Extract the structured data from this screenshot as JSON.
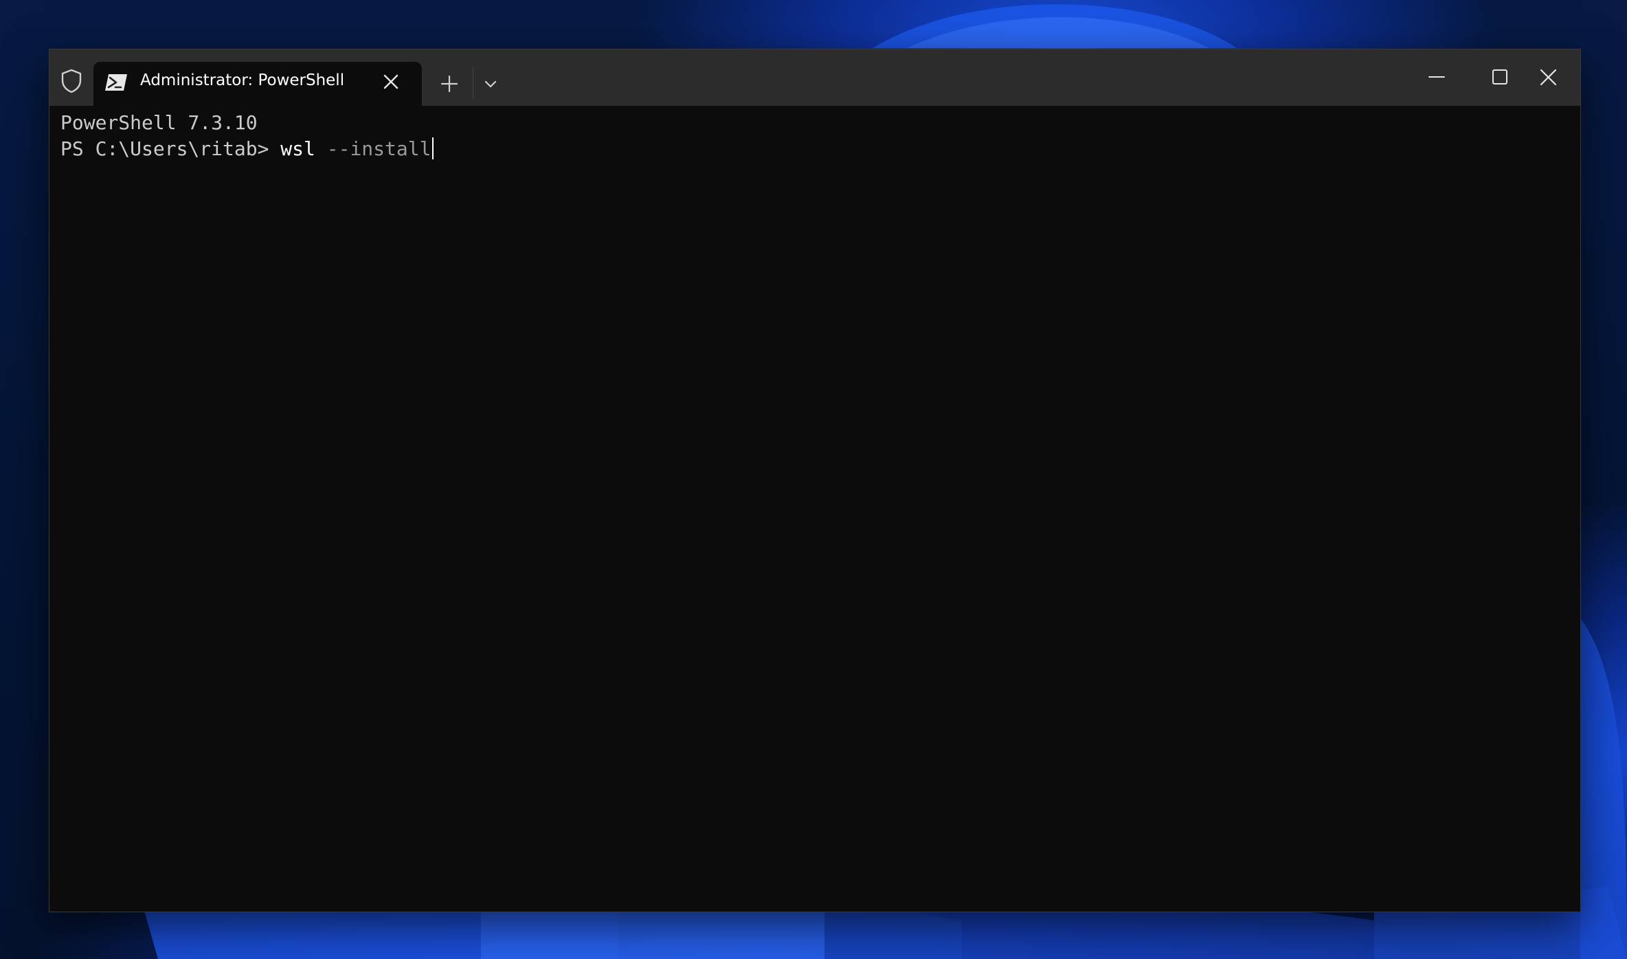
{
  "window": {
    "tab_title": "Administrator: PowerShell"
  },
  "terminal": {
    "line1": "PowerShell 7.3.10",
    "prompt": "PS C:\\Users\\ritab> ",
    "command": "wsl",
    "argument": " --install"
  },
  "icons": {
    "shield": "shield-icon",
    "powershell": "powershell-icon",
    "close_tab": "close-icon",
    "new_tab": "plus-icon",
    "dropdown": "chevron-down-icon",
    "minimize": "minimize-icon",
    "maximize": "maximize-icon",
    "close_window": "close-icon"
  },
  "colors": {
    "terminal_bg": "#0c0c0c",
    "titlebar_bg": "#2c2c2c",
    "text": "#cccccc",
    "argument_text": "#9a9a9a"
  }
}
